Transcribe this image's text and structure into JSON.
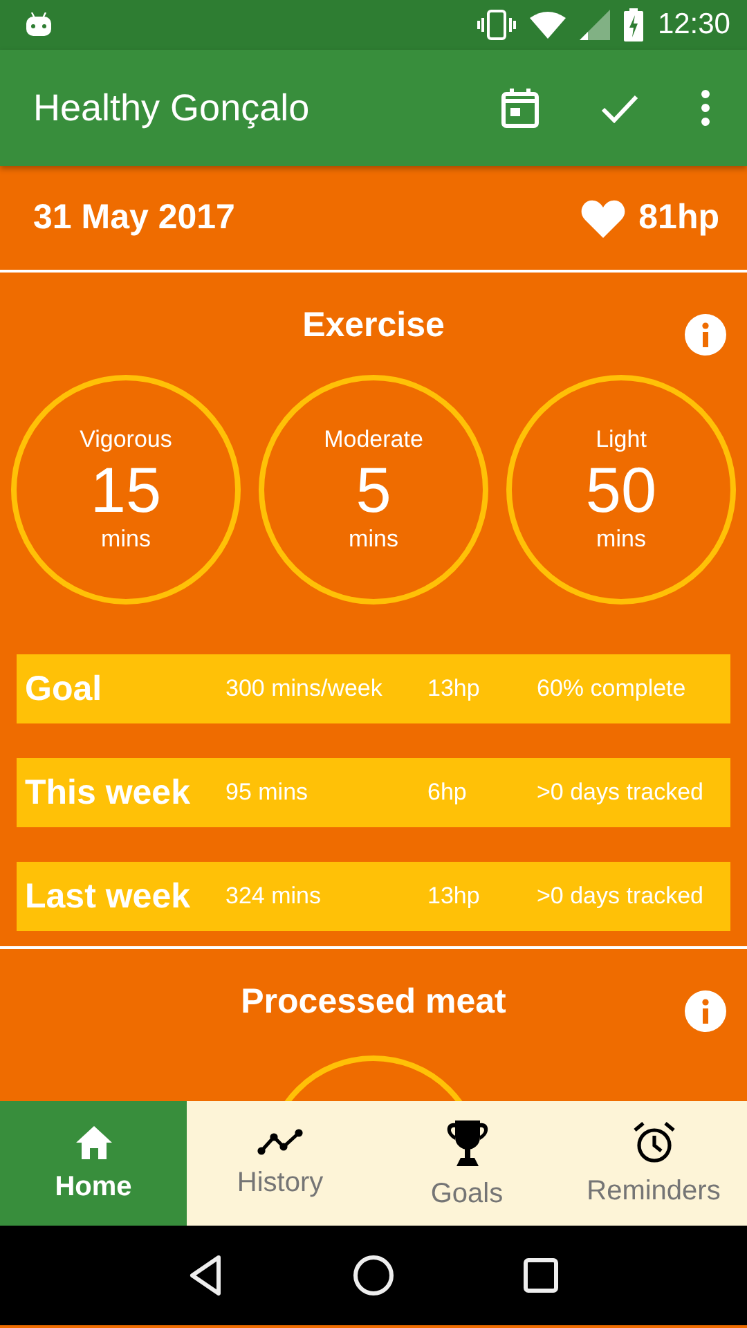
{
  "status_bar": {
    "time": "12:30"
  },
  "app_bar": {
    "title": "Healthy Gonçalo"
  },
  "header": {
    "date": "31 May 2017",
    "health": "81hp"
  },
  "exercise": {
    "title": "Exercise",
    "circles": [
      {
        "label": "Vigorous",
        "value": "15",
        "unit": "mins"
      },
      {
        "label": "Moderate",
        "value": "5",
        "unit": "mins"
      },
      {
        "label": "Light",
        "value": "50",
        "unit": "mins"
      }
    ],
    "rows": [
      {
        "label": "Goal",
        "amount": "300 mins/week",
        "points": "13hp",
        "note": "60% complete"
      },
      {
        "label": "This week",
        "amount": "95 mins",
        "points": "6hp",
        "note": ">0 days tracked"
      },
      {
        "label": "Last week",
        "amount": "324 mins",
        "points": "13hp",
        "note": ">0 days tracked"
      }
    ]
  },
  "processed_meat": {
    "title": "Processed meat"
  },
  "bottom_nav": [
    {
      "label": "Home",
      "kind": "home",
      "selected": true
    },
    {
      "label": "History",
      "kind": "history",
      "selected": false
    },
    {
      "label": "Goals",
      "kind": "goals",
      "selected": false
    },
    {
      "label": "Reminders",
      "kind": "reminders",
      "selected": false
    }
  ]
}
